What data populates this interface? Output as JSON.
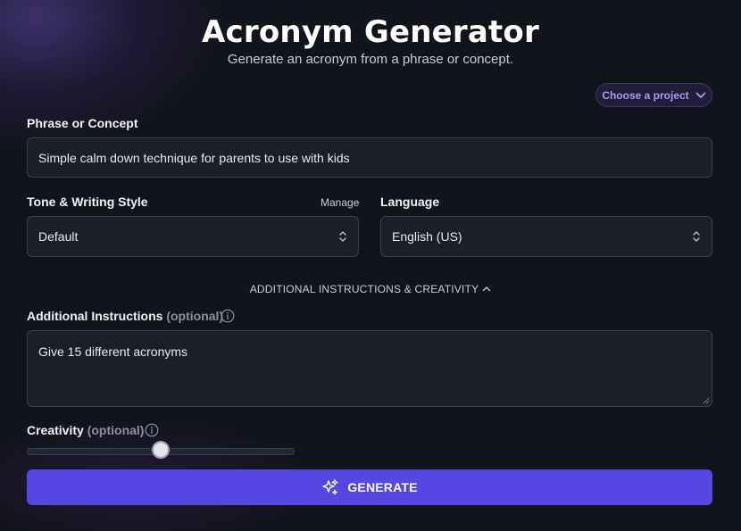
{
  "header": {
    "title": "Acronym Generator",
    "subtitle": "Generate an acronym from a phrase or concept."
  },
  "project": {
    "label": "Choose a project",
    "icon": "chevron-down-icon"
  },
  "phrase": {
    "label": "Phrase or Concept",
    "value": "Simple calm down technique for parents to use with kids"
  },
  "tone": {
    "label": "Tone & Writing Style",
    "manage_label": "Manage",
    "value": "Default",
    "icon": "chevron-up-down-icon"
  },
  "language": {
    "label": "Language",
    "value": "English (US)",
    "icon": "chevron-up-down-icon"
  },
  "advanced": {
    "toggle_label": "ADDITIONAL INSTRUCTIONS & CREATIVITY",
    "icon": "chevron-up-icon"
  },
  "instructions": {
    "label": "Additional Instructions",
    "optional": "(optional)",
    "value": "Give 15 different acronyms",
    "icon": "info-icon"
  },
  "creativity": {
    "label": "Creativity",
    "optional": "(optional)",
    "icon": "info-icon",
    "level": 0.5
  },
  "generate": {
    "label": "GENERATE",
    "icon": "sparkles-icon"
  },
  "colors": {
    "background": "#12141c",
    "field_bg": "#1b1f29",
    "accent": "#5548e0",
    "project_text": "#a99cf0"
  }
}
